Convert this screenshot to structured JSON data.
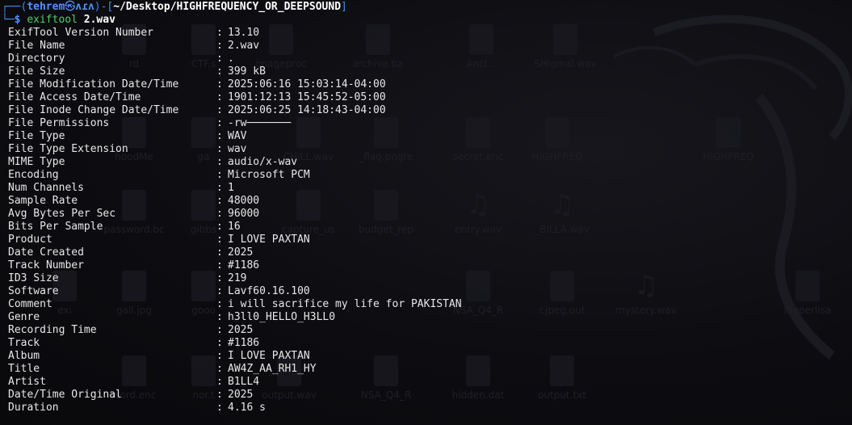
{
  "prompt": {
    "user": "tehrem",
    "at_symbol": "㉿",
    "host": "ʌɾʌ",
    "path": "~/Desktop/HIGHFREQUENCY_OR_DEEPSOUND",
    "dollar": "$",
    "command": "exiftool",
    "argument": "2.wav",
    "corner_top": "┌──(",
    "corner_mid": ")-[",
    "corner_end": "]",
    "corner_bottom": "└─"
  },
  "separator": ":",
  "metadata": [
    {
      "tag": "ExifTool Version Number",
      "value": "13.10"
    },
    {
      "tag": "File Name",
      "value": "2.wav"
    },
    {
      "tag": "Directory",
      "value": "."
    },
    {
      "tag": "File Size",
      "value": "399 kB"
    },
    {
      "tag": "File Modification Date/Time",
      "value": "2025:06:16 15:03:14-04:00"
    },
    {
      "tag": "File Access Date/Time",
      "value": "1901:12:13 15:45:52-05:00"
    },
    {
      "tag": "File Inode Change Date/Time",
      "value": "2025:06:25 14:18:43-04:00"
    },
    {
      "tag": "File Permissions",
      "value": "-rw───────"
    },
    {
      "tag": "File Type",
      "value": "WAV"
    },
    {
      "tag": "File Type Extension",
      "value": "wav"
    },
    {
      "tag": "MIME Type",
      "value": "audio/x-wav"
    },
    {
      "tag": "Encoding",
      "value": "Microsoft PCM"
    },
    {
      "tag": "Num Channels",
      "value": "1"
    },
    {
      "tag": "Sample Rate",
      "value": "48000"
    },
    {
      "tag": "Avg Bytes Per Sec",
      "value": "96000"
    },
    {
      "tag": "Bits Per Sample",
      "value": "16"
    },
    {
      "tag": "Product",
      "value": "I LOVE PAXTAN"
    },
    {
      "tag": "Date Created",
      "value": "2025"
    },
    {
      "tag": "Track Number",
      "value": "#1186"
    },
    {
      "tag": "ID3 Size",
      "value": "219"
    },
    {
      "tag": "Software",
      "value": "Lavf60.16.100"
    },
    {
      "tag": "Comment",
      "value": "i will sacrifice my life for PAKISTAN"
    },
    {
      "tag": "Genre",
      "value": "h3ll0_HELLO_H3LL0"
    },
    {
      "tag": "Recording Time",
      "value": "2025"
    },
    {
      "tag": "Track",
      "value": "#1186"
    },
    {
      "tag": "Album",
      "value": "I LOVE PAXTAN"
    },
    {
      "tag": "Title",
      "value": "AW4Z_AA_RH1_HY"
    },
    {
      "tag": "Artist",
      "value": "B1LL4"
    },
    {
      "tag": "Date/Time Original",
      "value": "2025"
    },
    {
      "tag": "Duration",
      "value": "4.16 s"
    }
  ],
  "desktop_icons": [
    {
      "label": "rd",
      "shape": "file"
    },
    {
      "label": "CTF.s",
      "shape": "file"
    },
    {
      "label": "imageproc",
      "shape": "file"
    },
    {
      "label": "archive.ba",
      "shape": "file"
    },
    {
      "label": "Ancl...",
      "shape": "file"
    },
    {
      "label": "SHiginal.wav",
      "shape": "file"
    },
    {
      "label": "hoodMe",
      "shape": "file"
    },
    {
      "label": "ga",
      "shape": "file"
    },
    {
      "label": "CHILL.wav",
      "shape": "file"
    },
    {
      "label": "_flag.pngre",
      "shape": "file"
    },
    {
      "label": "secret.enc",
      "shape": "file"
    },
    {
      "label": "HIGHFREQ",
      "shape": "file"
    },
    {
      "label": "HIGHFREQ",
      "shape": "file"
    },
    {
      "label": "password.bc",
      "shape": "file"
    },
    {
      "label": "gibbs",
      "shape": "file"
    },
    {
      "label": "capture_us",
      "shape": "file"
    },
    {
      "label": "budget_rep",
      "shape": "file"
    },
    {
      "label": "entry.wav",
      "shape": "note"
    },
    {
      "label": "_BILLA.wav",
      "shape": "note"
    },
    {
      "label": "exi",
      "shape": "file"
    },
    {
      "label": "gall.jpg",
      "shape": "file"
    },
    {
      "label": "gooo",
      "shape": "file"
    },
    {
      "label": "NSA_Q4_R",
      "shape": "file"
    },
    {
      "label": "r.jpeg.out",
      "shape": "file"
    },
    {
      "label": "mystery.wav",
      "shape": "note"
    },
    {
      "label": "Inoperlisa",
      "shape": "file"
    },
    {
      "label": "word.enc",
      "shape": "file"
    },
    {
      "label": "nor.t",
      "shape": "file"
    },
    {
      "label": "output.wav",
      "shape": "file"
    },
    {
      "label": "NSA_Q4_R",
      "shape": "file"
    },
    {
      "label": "hidden.dat",
      "shape": "file"
    },
    {
      "label": "output.txt",
      "shape": "file"
    }
  ]
}
